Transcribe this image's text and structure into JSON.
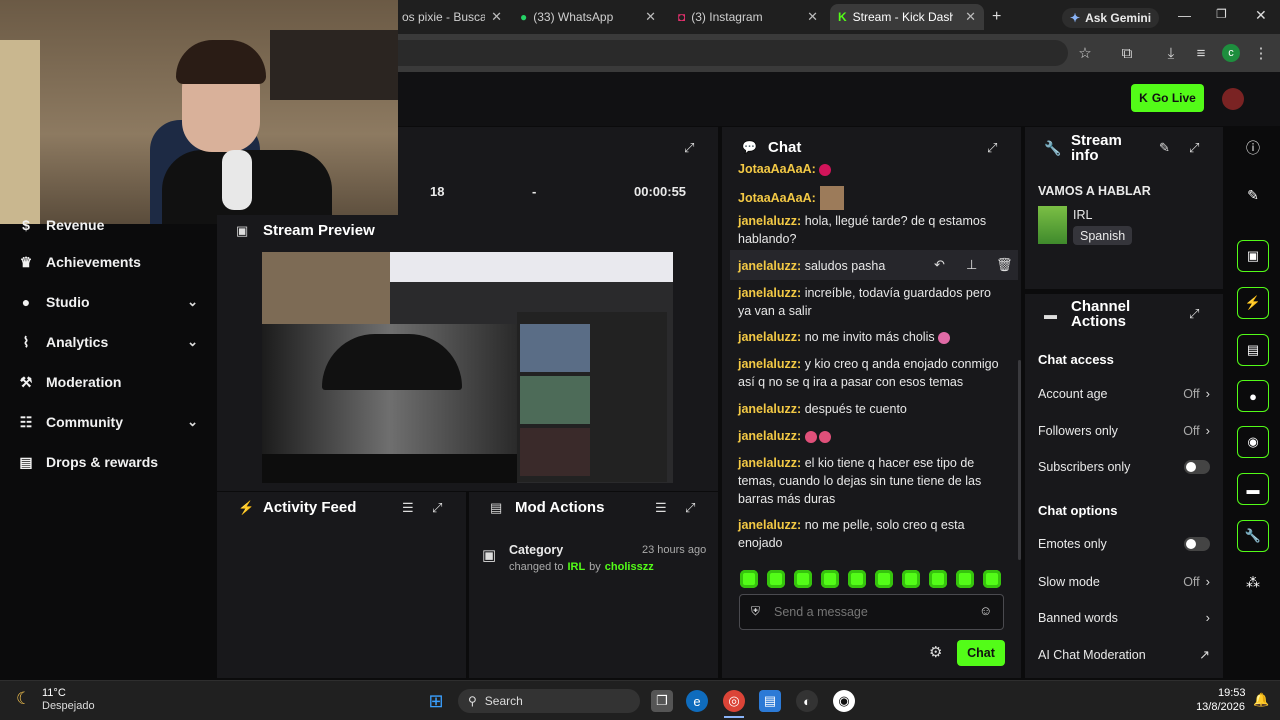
{
  "browser": {
    "tabs": [
      {
        "label": "os pixie - Buscar c",
        "icon": "search-tab-icon"
      },
      {
        "label": "(33) WhatsApp",
        "icon": "whatsapp-icon"
      },
      {
        "label": "(3) Instagram",
        "icon": "instagram-icon"
      },
      {
        "label": "Stream - Kick Dashbo",
        "icon": "kick-icon"
      }
    ],
    "new_tab": "+",
    "gemini": "Ask Gemini",
    "profile_initial": "c"
  },
  "header": {
    "go_live": "Go Live"
  },
  "stats": {
    "viewers": "18",
    "dash": "-",
    "uptime": "00:00:55"
  },
  "sidebar": {
    "items": [
      {
        "label": "Revenue",
        "icon": "revenue-icon",
        "chevron": false
      },
      {
        "label": "Achievements",
        "icon": "trophy-icon",
        "chevron": false
      },
      {
        "label": "Studio",
        "icon": "studio-icon",
        "chevron": true
      },
      {
        "label": "Analytics",
        "icon": "analytics-icon",
        "chevron": true
      },
      {
        "label": "Moderation",
        "icon": "hammer-icon",
        "chevron": false
      },
      {
        "label": "Community",
        "icon": "community-icon",
        "chevron": true
      },
      {
        "label": "Drops & rewards",
        "icon": "gift-icon",
        "chevron": false
      }
    ]
  },
  "preview": {
    "title": "Stream Preview"
  },
  "activity": {
    "title": "Activity Feed"
  },
  "mod_actions": {
    "title": "Mod Actions",
    "entry": {
      "title": "Category",
      "time": "23 hours ago",
      "pre": "changed to",
      "category": "IRL",
      "by": "by",
      "user": "cholisszz"
    }
  },
  "chat": {
    "title": "Chat",
    "messages": [
      {
        "user": "JotaaAaAaA:",
        "text": ""
      },
      {
        "user": "janelaluzz:",
        "text": "hola, llegué tarde? de q estamos hablando?"
      },
      {
        "user": "janelaluzz:",
        "text": "saludos pasha"
      },
      {
        "user": "janelaluzz:",
        "text": "increíble, todavía guardados pero ya van a salir"
      },
      {
        "user": "janelaluzz:",
        "text": "no me invito más cholis"
      },
      {
        "user": "janelaluzz:",
        "text": "y kio creo q anda enojado conmigo así q no se q ira a pasar con esos temas"
      },
      {
        "user": "janelaluzz:",
        "text": "después te cuento"
      },
      {
        "user": "janelaluzz:",
        "text": ""
      },
      {
        "user": "janelaluzz:",
        "text": "el kio tiene q hacer ese tipo de temas, cuando lo dejas sin tune tiene de las barras más duras"
      },
      {
        "user": "janelaluzz:",
        "text": "no me pelle, solo creo q esta enojado"
      }
    ],
    "input_placeholder": "Send a message",
    "send_label": "Chat"
  },
  "stream_info": {
    "title_line1": "Stream",
    "title_line2": "info",
    "stream_title": "VAMOS A HABLAR",
    "category": "IRL",
    "language": "Spanish"
  },
  "channel_actions": {
    "title_line1": "Channel",
    "title_line2": "Actions",
    "chat_access": "Chat access",
    "account_age": {
      "label": "Account age",
      "value": "Off"
    },
    "followers_only": {
      "label": "Followers only",
      "value": "Off"
    },
    "subscribers_only": {
      "label": "Subscribers only"
    },
    "chat_options": "Chat options",
    "emotes_only": {
      "label": "Emotes only"
    },
    "slow_mode": {
      "label": "Slow mode",
      "value": "Off"
    },
    "banned_words": {
      "label": "Banned words"
    },
    "ai_moderation": {
      "label": "AI Chat Moderation"
    }
  },
  "taskbar": {
    "temp": "11°C",
    "weather": "Despejado",
    "search": "Search",
    "time": "19:53",
    "date": "13/8/2026"
  },
  "colors": {
    "accent": "#53fc18",
    "username": "#f3c945",
    "panel": "#18181b"
  }
}
